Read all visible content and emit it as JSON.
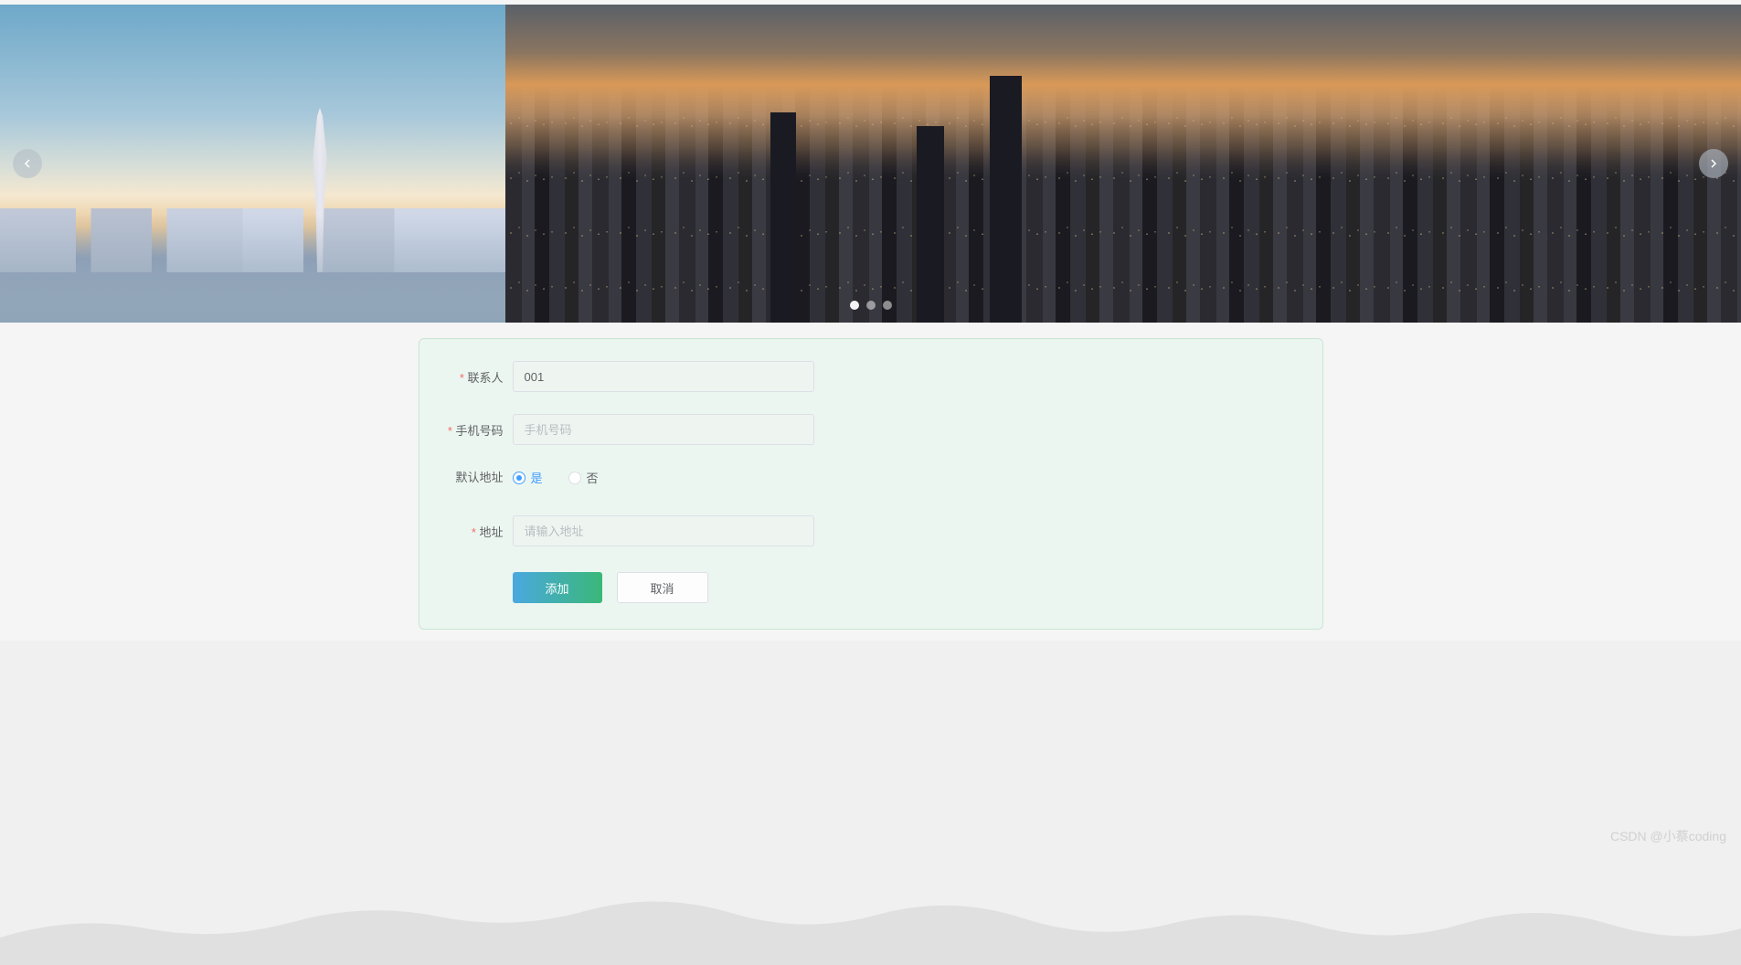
{
  "carousel": {
    "dots_count": 3,
    "active_dot": 0
  },
  "form": {
    "contact": {
      "label": "联系人",
      "value": "001",
      "required": true
    },
    "phone": {
      "label": "手机号码",
      "placeholder": "手机号码",
      "value": "",
      "required": true
    },
    "default_address": {
      "label": "默认地址",
      "options": {
        "yes": "是",
        "no": "否"
      },
      "selected": "yes"
    },
    "address": {
      "label": "地址",
      "placeholder": "请输入地址",
      "value": "",
      "required": true
    },
    "buttons": {
      "submit": "添加",
      "cancel": "取消"
    }
  },
  "watermark": "CSDN @小蔡coding"
}
